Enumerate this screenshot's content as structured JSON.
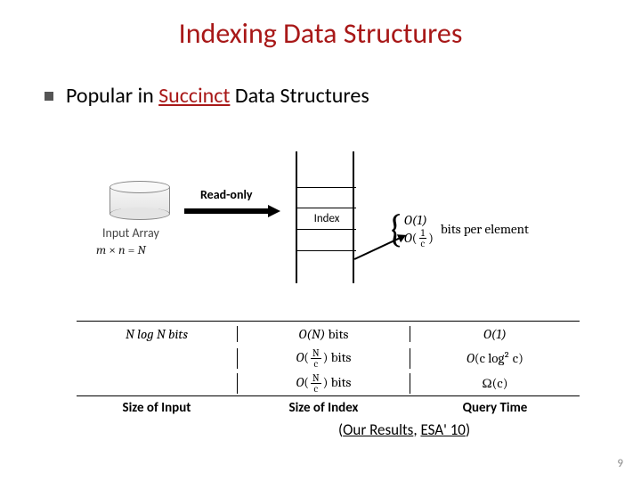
{
  "title": "Indexing Data Structures",
  "bullet": {
    "prefix": "Popular in ",
    "emphasis": "Succinct",
    "suffix": " Data Structures"
  },
  "diagram": {
    "input_array_label": "Input Array",
    "input_formula_m": "m",
    "input_formula_times": " × ",
    "input_formula_n": "n",
    "input_formula_eq": " = ",
    "input_formula_N": "N",
    "readonly_label": "Read-only",
    "index_label": "Index",
    "brace_line1": "O(1)",
    "brace_line2_prefix": "O",
    "brace_line2_num": "1",
    "brace_line2_den": "c",
    "brace_suffix": "bits per element"
  },
  "table": {
    "headers": {
      "col1": "Size of Input",
      "col2": "Size of Index",
      "col3": "Query Time"
    },
    "rows": [
      {
        "col1": "N log N bits",
        "col2_prefix": "O(N)",
        "col2_suffix": " bits",
        "col3": "O(1)"
      },
      {
        "col1": "",
        "col2_O": "O",
        "col2_num": "N",
        "col2_den": "c",
        "col2_suffix": " bits",
        "col3_O": "O",
        "col3_expr": "(c log² c)"
      },
      {
        "col1": "",
        "col2_O": "O",
        "col2_num": "N",
        "col2_den": "c",
        "col2_suffix": " bits",
        "col3": "Ω(c)"
      }
    ]
  },
  "citation": {
    "open": "(",
    "part1": "Our Results",
    "sep": ", ",
    "part2": "ESA' 10",
    "close": ")"
  },
  "page_number": "9"
}
